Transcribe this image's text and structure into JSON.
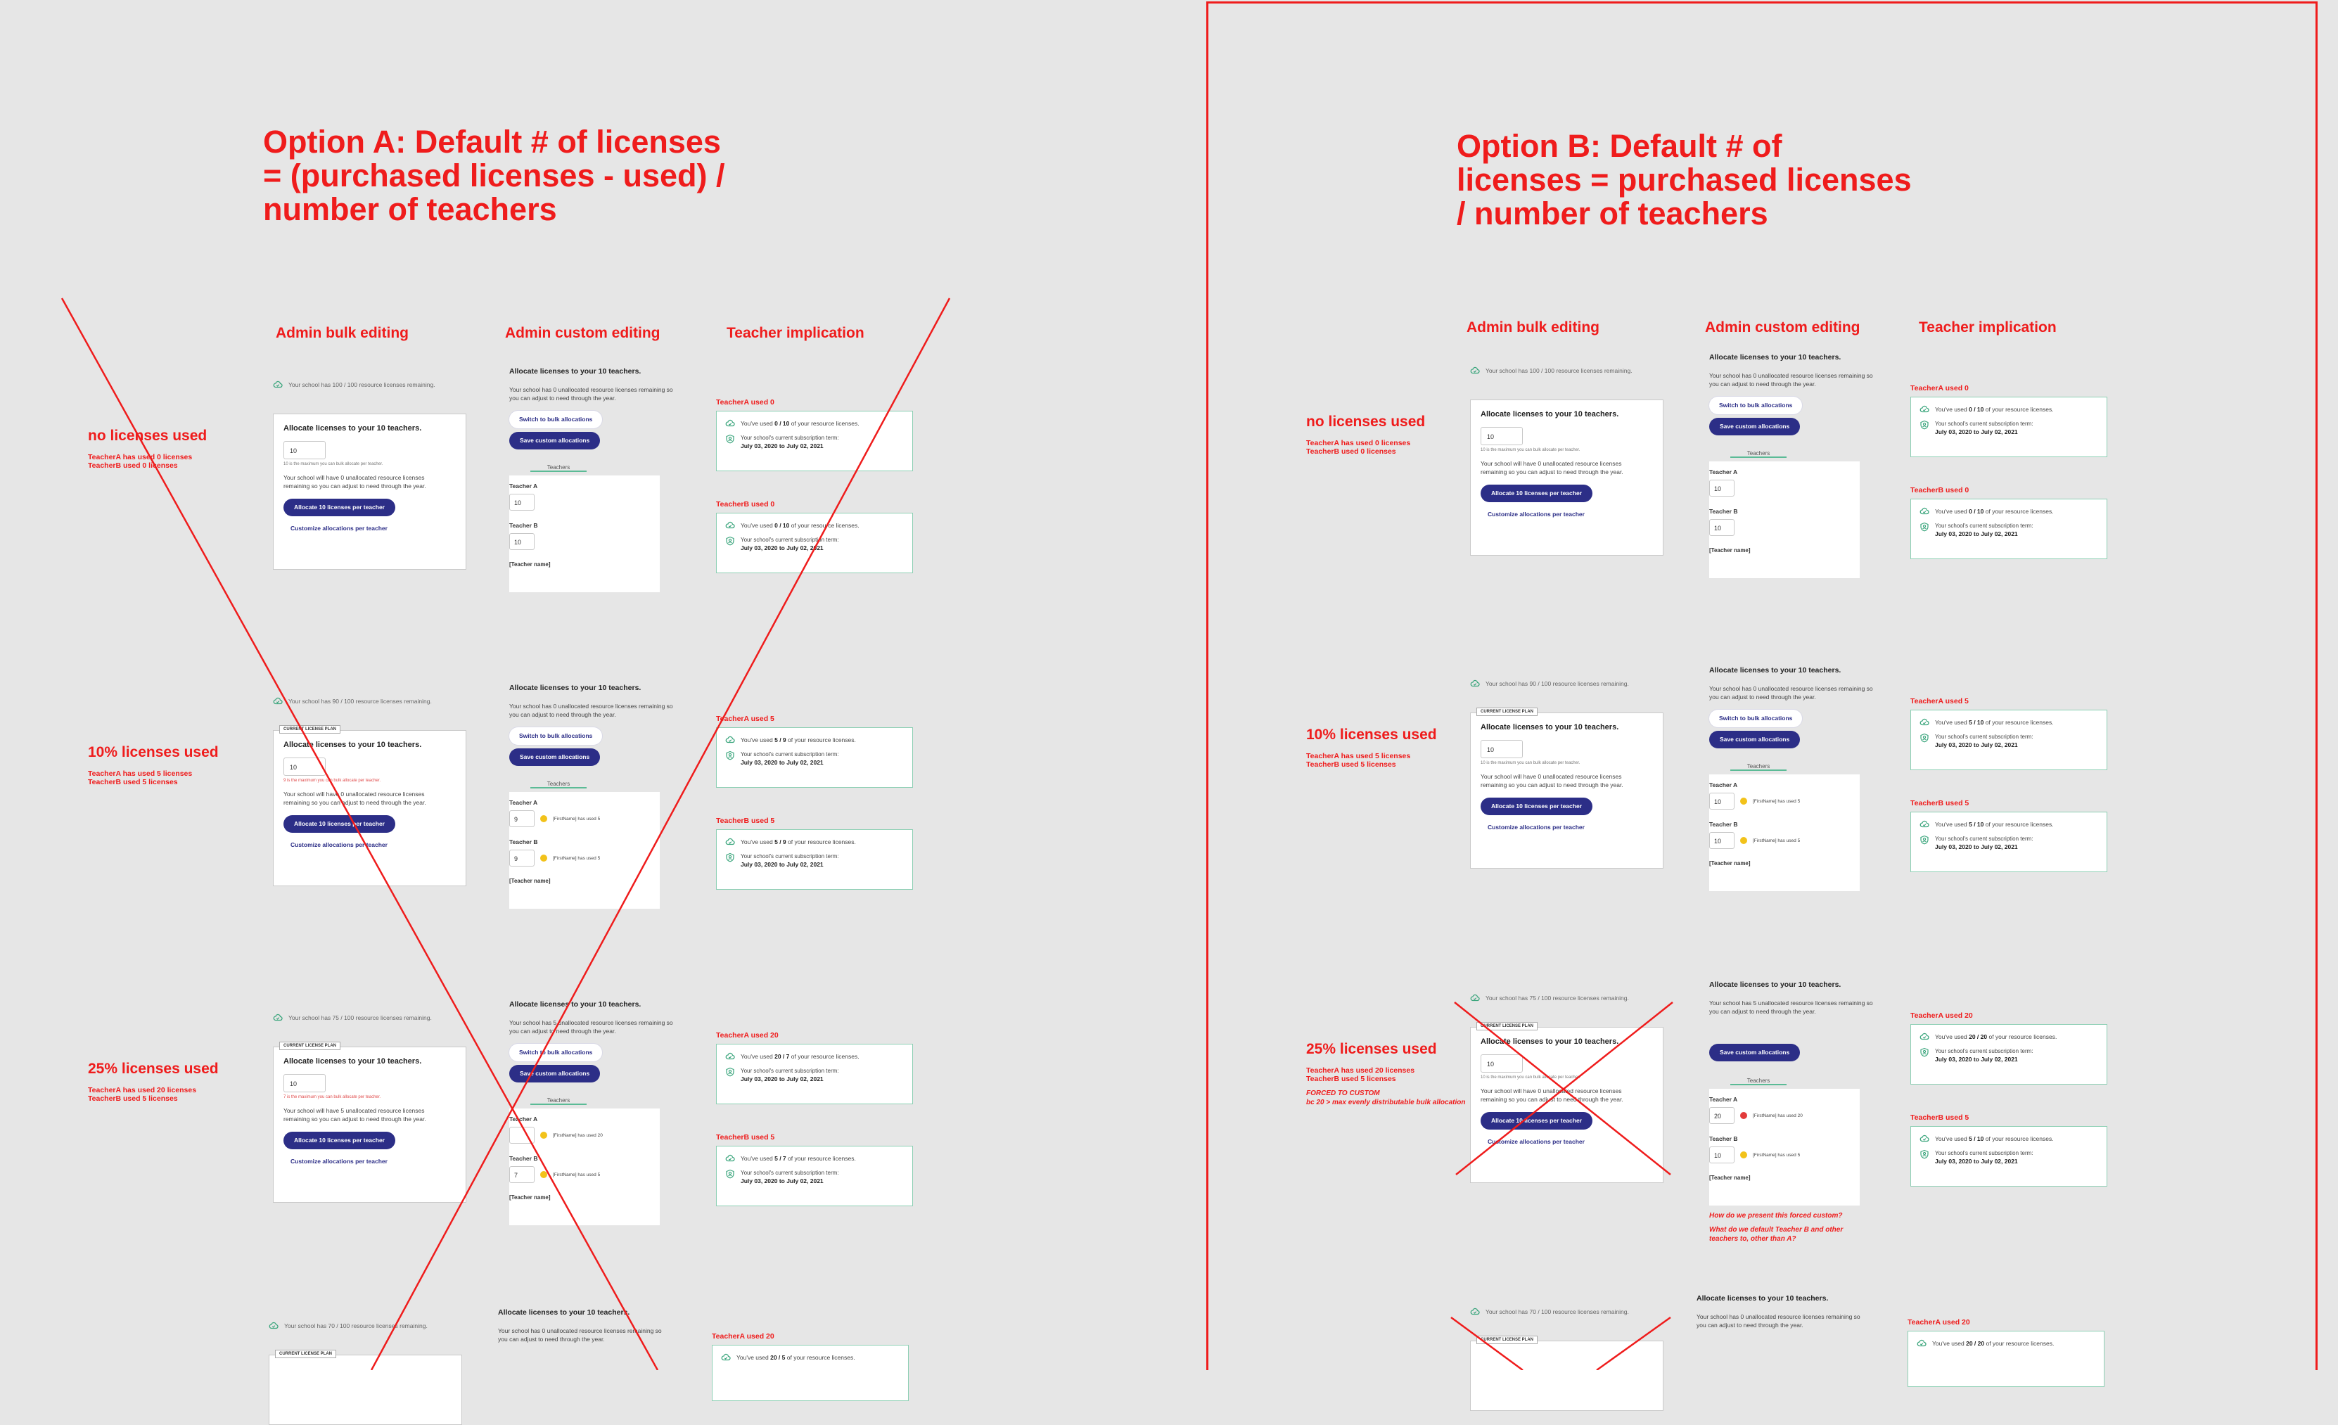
{
  "option_a": {
    "title": "Option A: Default # of licenses = (purchased licenses - used) / number of teachers",
    "columns": [
      "Admin bulk editing",
      "Admin custom editing",
      "Teacher implication"
    ],
    "scenarios": [
      {
        "title": "no licenses used",
        "sub1": "TeacherA has used 0 licenses",
        "sub2": "TeacherB used 0 licenses",
        "remaining": "Your school has 100 / 100 resource licenses remaining.",
        "bulk_value": "10",
        "bulk_hint": "10 is the maximum you can bulk allocate per teacher.",
        "unallocated": "Your school will have 0 unallocated resource licenses remaining so you can adjust to need through the year.",
        "custom_unallocated": "Your school has 0 unallocated resource licenses remaining so you can adjust to need through the year.",
        "teacherA_value": "10",
        "teacherA_note": "",
        "teacherB_value": "10",
        "teacherB_note": "",
        "tA_head": "TeacherA used 0",
        "tA_usage_pre": "You've used ",
        "tA_usage": "0 / 10",
        "tA_usage_post": " of your resource licenses.",
        "tB_head": "TeacherB used 0",
        "tB_usage_pre": "You've used ",
        "tB_usage": "0 / 10",
        "tB_usage_post": " of your resource licenses."
      },
      {
        "title": "10% licenses used",
        "sub1": "TeacherA has used 5 licenses",
        "sub2": "TeacherB used 5 licenses",
        "remaining": "Your school has 90 / 100 resource licenses remaining.",
        "bulk_value": "10",
        "bulk_hint": "9 is the maximum you can bulk allocate per teacher.",
        "unallocated": "Your school will have 0 unallocated resource licenses remaining so you can adjust to need through the year.",
        "custom_unallocated": "Your school has 0 unallocated resource licenses remaining so you can adjust to need through the year.",
        "teacherA_value": "9",
        "teacherA_note": "[FirstName] has used 5",
        "teacherB_value": "9",
        "teacherB_note": "[FirstName] has used 5",
        "tA_head": "TeacherA used 5",
        "tA_usage_pre": "You've used ",
        "tA_usage": "5 / 9",
        "tA_usage_post": " of your resource licenses.",
        "tB_head": "TeacherB used 5",
        "tB_usage_pre": "You've used ",
        "tB_usage": "5 / 9",
        "tB_usage_post": " of your resource licenses."
      },
      {
        "title": "25% licenses used",
        "sub1": "TeacherA has used 20 licenses",
        "sub2": "TeacherB used 5 licenses",
        "remaining": "Your school has 75 / 100 resource licenses remaining.",
        "bulk_value": "10",
        "bulk_hint": "7 is the maximum you can bulk allocate per teacher.",
        "unallocated": "Your school will have 5 unallocated resource licenses remaining so you can adjust to need through the year.",
        "custom_unallocated": "Your school has 5 unallocated resource licenses remaining so you can adjust to need through the year.",
        "teacherA_value": "",
        "teacherA_note": "[FirstName] has used 20",
        "teacherB_value": "7",
        "teacherB_note": "[FirstName] has used 5",
        "tA_head": "TeacherA used 20",
        "tA_usage_pre": "You've used ",
        "tA_usage": "20 / 7",
        "tA_usage_post": " of your resource licenses.",
        "tB_head": "TeacherB used 5",
        "tB_usage_pre": "You've used ",
        "tB_usage": "5 / 7",
        "tB_usage_post": " of your resource licenses."
      }
    ],
    "partial": {
      "remaining": "Your school has 70 / 100 resource licenses remaining.",
      "tA_head": "TeacherA used 20",
      "tA_usage_pre": "You've used ",
      "tA_usage": "20 / 5",
      "tA_usage_post": " of your resource licenses."
    }
  },
  "option_b": {
    "title": "Option B: Default # of licenses = purchased licenses / number of teachers",
    "columns": [
      "Admin bulk editing",
      "Admin custom editing",
      "Teacher implication"
    ],
    "scenarios": [
      {
        "title": "no licenses used",
        "sub1": "TeacherA has used 0 licenses",
        "sub2": "TeacherB used 0 licenses",
        "remaining": "Your school has 100 / 100 resource licenses remaining.",
        "bulk_value": "10",
        "bulk_hint": "10 is the maximum you can bulk allocate per teacher.",
        "unallocated": "Your school will have 0 unallocated resource licenses remaining so you can adjust to need through the year.",
        "custom_unallocated": "Your school has 0 unallocated resource licenses remaining so you can adjust to need through the year.",
        "teacherA_value": "10",
        "teacherA_note": "",
        "teacherB_value": "10",
        "teacherB_note": "",
        "tA_head": "TeacherA used 0",
        "tA_usage_pre": "You've used ",
        "tA_usage": "0 / 10",
        "tA_usage_post": " of your resource licenses.",
        "tB_head": "TeacherB used 0",
        "tB_usage_pre": "You've used ",
        "tB_usage": "0 / 10",
        "tB_usage_post": " of your resource licenses."
      },
      {
        "title": "10% licenses used",
        "sub1": "TeacherA has used 5 licenses",
        "sub2": "TeacherB used 5 licenses",
        "remaining": "Your school has 90 / 100 resource licenses remaining.",
        "bulk_value": "10",
        "bulk_hint": "10 is the maximum you can bulk allocate per teacher.",
        "unallocated": "Your school will have 0 unallocated resource licenses remaining so you can adjust to need through the year.",
        "custom_unallocated": "Your school has 0 unallocated resource licenses remaining so you can adjust to need through the year.",
        "teacherA_value": "10",
        "teacherA_note": "[FirstName] has used 5",
        "teacherB_value": "10",
        "teacherB_note": "[FirstName] has used 5",
        "tA_head": "TeacherA used 5",
        "tA_usage_pre": "You've used ",
        "tA_usage": "5 / 10",
        "tA_usage_post": " of your resource licenses.",
        "tB_head": "TeacherB used 5",
        "tB_usage_pre": "You've used ",
        "tB_usage": "5 / 10",
        "tB_usage_post": " of your resource licenses."
      },
      {
        "title": "25% licenses used",
        "sub1": "TeacherA has used 20 licenses",
        "sub2": "TeacherB used 5 licenses",
        "remaining": "Your school has 75 / 100 resource licenses remaining.",
        "bulk_value": "10",
        "bulk_hint": "10 is the maximum you can bulk allocate per teacher.",
        "unallocated": "Your school will have 0 unallocated resource licenses remaining so you can adjust to need through the year.",
        "custom_unallocated": "Your school has 5 unallocated resource licenses remaining so you can adjust to need through the year.",
        "teacherA_value": "20",
        "teacherA_note": "[FirstName] has used 20",
        "teacherB_value": "10",
        "teacherB_note": "[FirstName] has used 5",
        "tA_head": "TeacherA used 20",
        "tA_usage_pre": "You've used ",
        "tA_usage": "20 / 20",
        "tA_usage_post": " of your resource licenses.",
        "tB_head": "TeacherB used 5",
        "tB_usage_pre": "You've used ",
        "tB_usage": "5 / 10",
        "tB_usage_post": " of your resource licenses.",
        "forced_1": "FORCED TO CUSTOM",
        "forced_2": "bc 20 > max evenly distributable bulk allocation",
        "q1": "How do we present this forced custom?",
        "q2": "What do we default Teacher B and other teachers to, other than A?"
      }
    ],
    "partial": {
      "remaining": "Your school has 70 / 100 resource licenses remaining.",
      "tA_head": "TeacherA used 20",
      "tA_usage_pre": "You've used ",
      "tA_usage": "20 / 20",
      "tA_usage_post": " of your resource licenses."
    }
  },
  "common": {
    "badge": "CURRENT LICENSE PLAN",
    "allocate_heading": "Allocate licenses to your 10 teachers.",
    "allocate_btn": "Allocate 10 licenses per teacher",
    "customize_link": "Customize allocations per teacher",
    "switch_btn": "Switch to bulk allocations",
    "save_btn": "Save custom allocations",
    "teachers_tab": "Teachers",
    "teacher_a": "Teacher A",
    "teacher_b": "Teacher B",
    "teacher_name": "[Teacher name]",
    "sub_term": "Your school's current subscription term:",
    "sub_dates": "July 03, 2020 to July 02, 2021"
  },
  "colors": {
    "accent_red": "#ef1c1c",
    "primary_navy": "#2c2e87",
    "teal": "#5bbb96",
    "warn_yellow": "#f2c21a",
    "error_red": "#e23b3b"
  },
  "icons": [
    "cloud-check-icon",
    "shield-user-icon",
    "status-dot-icon"
  ]
}
